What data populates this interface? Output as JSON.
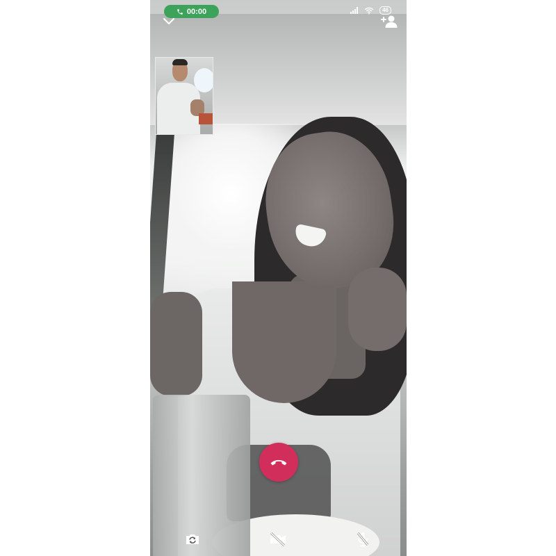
{
  "status_bar": {
    "call_timer": "00:00",
    "battery_level": "46",
    "pill_color": "#3da35a"
  },
  "top_controls": {
    "minimize_icon": "chevron-down-icon",
    "add_participant_icon": "add-person-icon"
  },
  "self_preview": {
    "visible": true
  },
  "call_controls": {
    "end_call_icon": "end-call-icon",
    "end_call_color": "#d22e5b",
    "switch_camera_icon": "switch-camera-icon",
    "video_off_icon": "video-off-icon",
    "mute_icon": "mic-off-icon"
  }
}
